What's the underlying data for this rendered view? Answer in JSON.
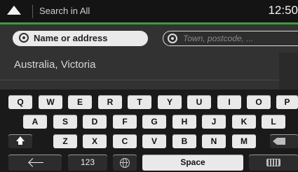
{
  "header": {
    "nav_icon": "navigation-arrow-icon",
    "search_label": "Search in All",
    "clock": "12:50"
  },
  "search": {
    "name_field_label": "Name or address",
    "town_field_placeholder": "Town, postcode, ..."
  },
  "location": {
    "country_state": "Australia, Victoria"
  },
  "keyboard": {
    "row1": [
      "Q",
      "W",
      "E",
      "R",
      "T",
      "Y",
      "U",
      "I",
      "O",
      "P"
    ],
    "row2": [
      "A",
      "S",
      "D",
      "F",
      "G",
      "H",
      "J",
      "K",
      "L"
    ],
    "row3": [
      "Z",
      "X",
      "C",
      "V",
      "B",
      "N",
      "M"
    ],
    "numbers_label": "123",
    "space_label": "Space"
  },
  "colors": {
    "accent_green": "#3f9a3c",
    "key_face": "#e9e9e9",
    "panel": "#323232"
  }
}
